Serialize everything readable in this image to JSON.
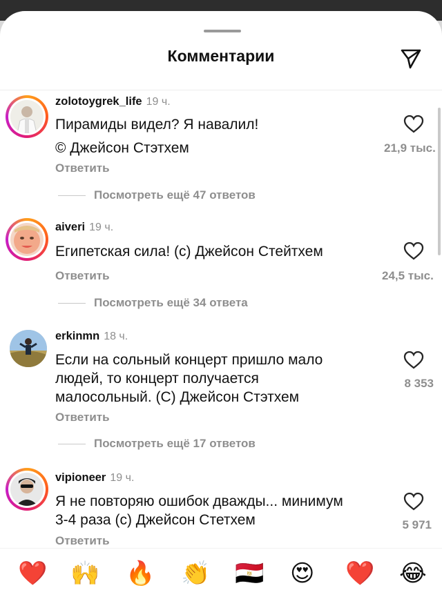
{
  "header": {
    "title": "Комментарии",
    "share_icon": "send-icon"
  },
  "comments": [
    {
      "username": "zolotoygrek_life",
      "time": "19 ч.",
      "text_lines": [
        "Пирамиды видел? Я навалил!",
        "© Джейсон Стэтхем"
      ],
      "reply_label": "Ответить",
      "likes": "21,9 тыс.",
      "more_replies": "Посмотреть ещё 47 ответов"
    },
    {
      "username": "aiveri",
      "time": "19 ч.",
      "text_lines": [
        "Египетская сила! (с) Джейсон Стейтхем"
      ],
      "reply_label": "Ответить",
      "likes": "24,5 тыс.",
      "more_replies": "Посмотреть ещё 34 ответа"
    },
    {
      "username": "erkinmn",
      "time": "18 ч.",
      "text_lines": [
        "Если на сольный концерт пришло мало",
        "людей, то концерт получается",
        "малосольный. (С) Джейсон Стэтхем"
      ],
      "reply_label": "Ответить",
      "likes": "8 353",
      "more_replies": "Посмотреть ещё 17 ответов"
    },
    {
      "username": "vipioneer",
      "time": "19 ч.",
      "text_lines": [
        "Я не повторяю ошибок дважды... минимум",
        "3-4 раза (с) Джейсон Стетхем"
      ],
      "reply_label": "Ответить",
      "likes": "5 971"
    }
  ],
  "emoji_bar": [
    "❤️",
    "🙌",
    "🔥",
    "👏",
    "🇪🇬",
    "😍",
    "❤️",
    "😂"
  ],
  "colors": {
    "muted": "#8e8e8e",
    "story_ring_start": "#ff9f1a",
    "story_ring_end": "#c71ec7"
  }
}
